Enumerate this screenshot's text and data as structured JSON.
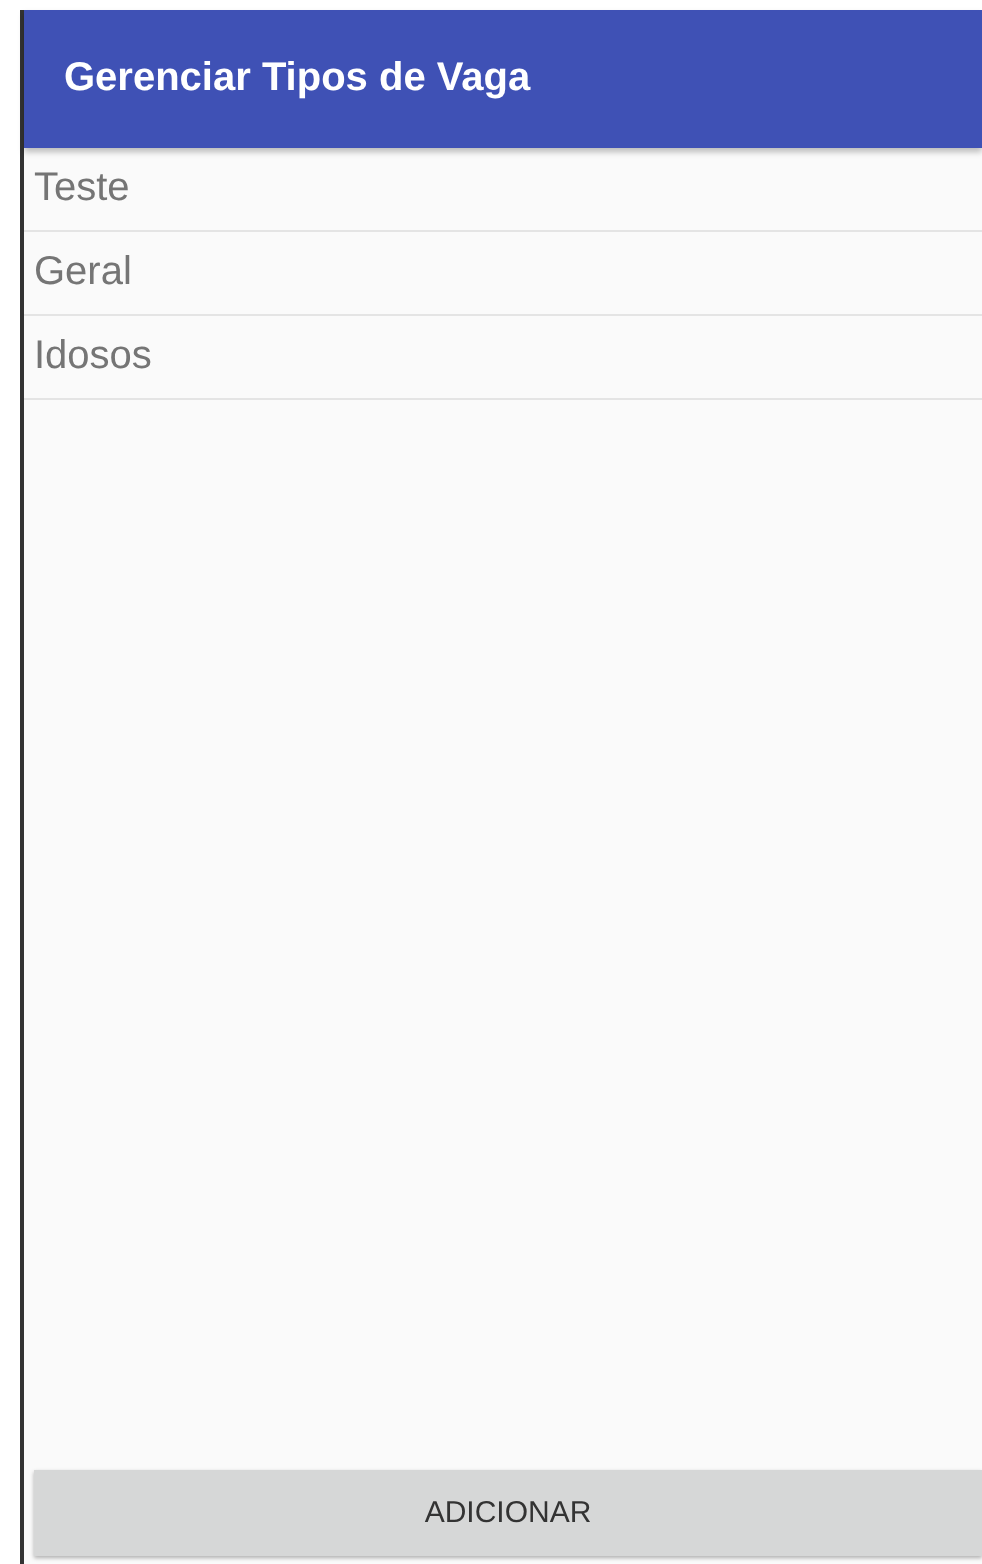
{
  "app_bar": {
    "title": "Gerenciar Tipos de Vaga"
  },
  "list": [
    {
      "label": "Teste"
    },
    {
      "label": "Geral"
    },
    {
      "label": "Idosos"
    }
  ],
  "add_button": {
    "label": "ADICIONAR"
  }
}
